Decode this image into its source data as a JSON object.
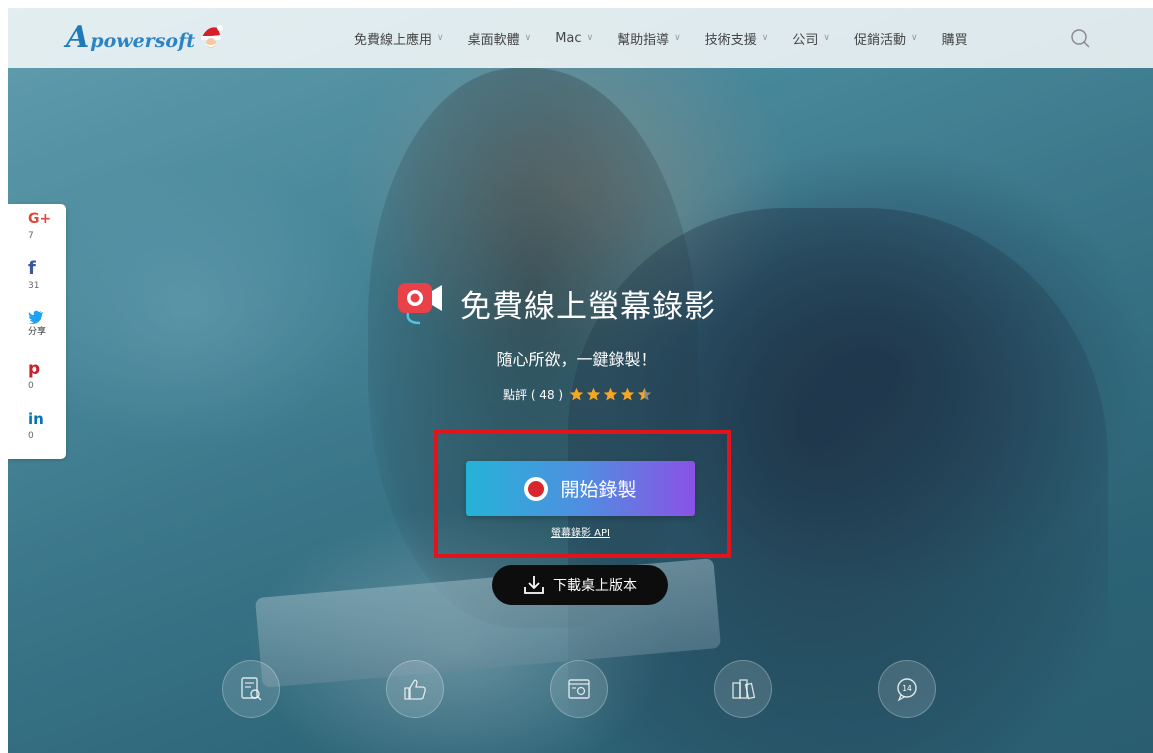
{
  "header": {
    "logo_text": "powersoft",
    "logo_letter": "A",
    "nav": [
      {
        "label": "免費線上應用",
        "has_dropdown": true
      },
      {
        "label": "桌面軟體",
        "has_dropdown": true
      },
      {
        "label": "Mac",
        "has_dropdown": true
      },
      {
        "label": "幫助指導",
        "has_dropdown": true
      },
      {
        "label": "技術支援",
        "has_dropdown": true
      },
      {
        "label": "公司",
        "has_dropdown": true
      },
      {
        "label": "促銷活動",
        "has_dropdown": true
      },
      {
        "label": "購買",
        "has_dropdown": false
      }
    ],
    "chevron": "∨",
    "search_icon": "search-icon"
  },
  "share": {
    "items": [
      {
        "icon": "G+",
        "count": "7",
        "color": "#dd4b39"
      },
      {
        "icon": "f",
        "count": "31",
        "color": "#3b5998"
      },
      {
        "icon": "🐦",
        "count": "分享",
        "color": "#1da1f2"
      },
      {
        "icon": "p",
        "count": "0",
        "color": "#cb2027"
      },
      {
        "icon": "in",
        "count": "0",
        "color": "#0077b5"
      }
    ]
  },
  "hero": {
    "title": "免費線上螢幕錄影",
    "subtitle": "隨心所欲，一鍵錄製！",
    "rating_label": "點評 ( 48 )",
    "rating_value": 4.5,
    "rating_max": 5,
    "record_button": "開始錄製",
    "api_link": "螢幕錄影 API",
    "download_button": "下載桌上版本"
  },
  "features": [
    {
      "icon": "document-search-icon"
    },
    {
      "icon": "thumbs-up-icon"
    },
    {
      "icon": "screenshot-icon"
    },
    {
      "icon": "files-icon"
    },
    {
      "icon": "chat-count-icon",
      "badge": "14"
    }
  ],
  "colors": {
    "accent_red": "#e1141b",
    "button_gradient_start": "#25b3d7",
    "button_gradient_end": "#8a52e6",
    "star": "#f5a623"
  }
}
